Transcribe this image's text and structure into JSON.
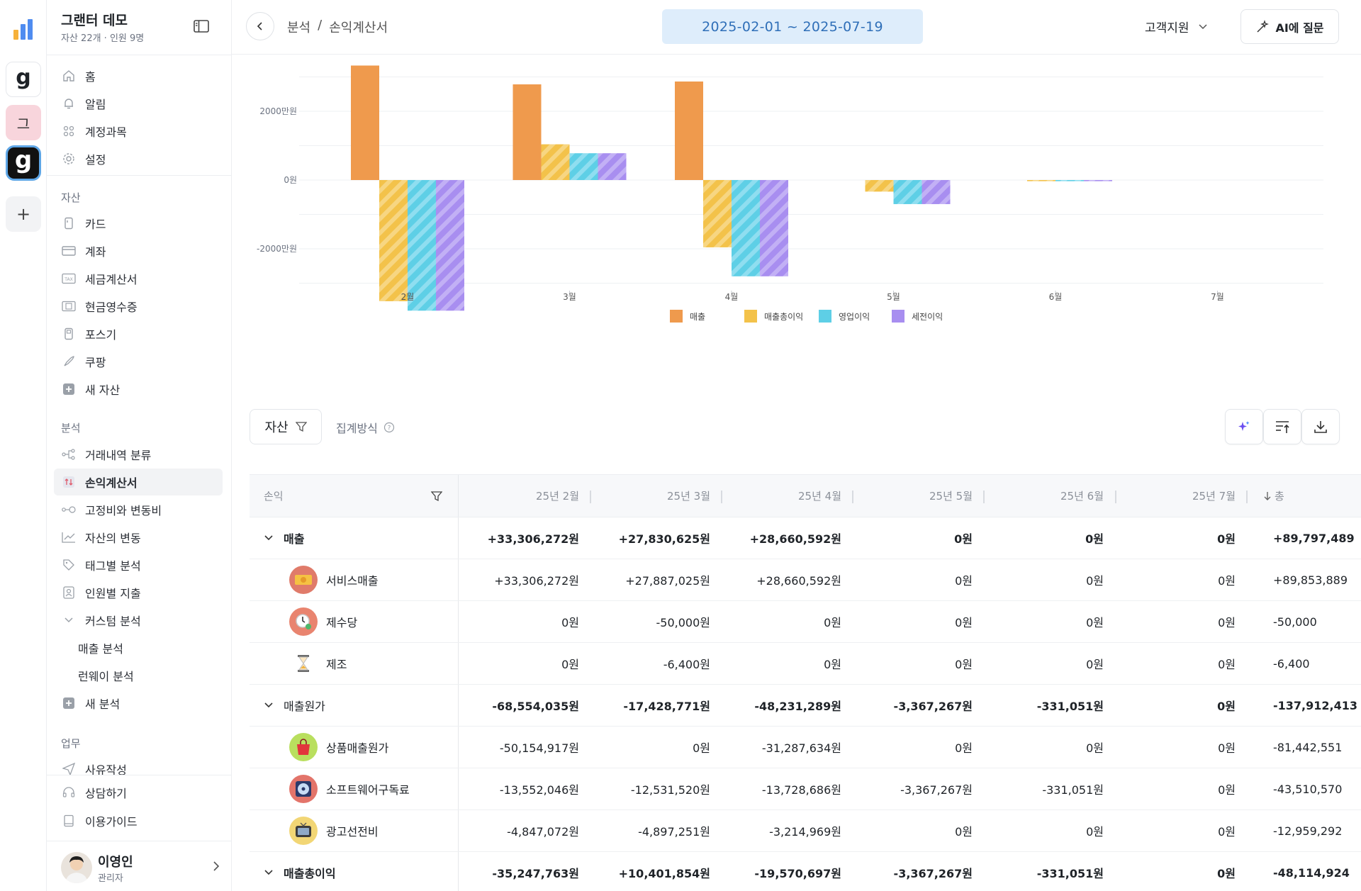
{
  "rail": {
    "items": [
      {
        "name": "analytics-app",
        "label": ""
      },
      {
        "name": "g-workspace-1",
        "label": "g"
      },
      {
        "name": "workspace-geu",
        "label": "그"
      },
      {
        "name": "g-workspace-active",
        "label": "g"
      },
      {
        "name": "add-workspace",
        "label": "+"
      }
    ]
  },
  "sidebar": {
    "workspace_name": "그랜터 데모",
    "workspace_sub": "자산 22개 · 인원 9명",
    "top_items": [
      {
        "label": "홈",
        "icon": "home-icon"
      },
      {
        "label": "알림",
        "icon": "bell-icon"
      },
      {
        "label": "계정과목",
        "icon": "grid-icon"
      },
      {
        "label": "설정",
        "icon": "gear-icon"
      }
    ],
    "assets_label": "자산",
    "asset_items": [
      {
        "label": "카드",
        "icon": "card-icon"
      },
      {
        "label": "계좌",
        "icon": "bank-icon"
      },
      {
        "label": "세금계산서",
        "icon": "tax-icon"
      },
      {
        "label": "현금영수증",
        "icon": "receipt-icon"
      },
      {
        "label": "포스기",
        "icon": "pos-icon"
      },
      {
        "label": "쿠팡",
        "icon": "rocket-icon"
      },
      {
        "label": "새 자산",
        "icon": "plus-square-icon"
      }
    ],
    "analysis_label": "분석",
    "analysis_items": [
      {
        "label": "거래내역 분류",
        "icon": "flow-icon"
      },
      {
        "label": "손익계산서",
        "icon": "pl-icon"
      },
      {
        "label": "고정비와 변동비",
        "icon": "dots-icon"
      },
      {
        "label": "자산의 변동",
        "icon": "trend-icon"
      },
      {
        "label": "태그별 분석",
        "icon": "tag-icon"
      },
      {
        "label": "인원별 지출",
        "icon": "person-icon"
      },
      {
        "label": "커스텀 분석",
        "icon": "chevron-down-icon"
      }
    ],
    "custom_sub_items": [
      "매출 분석",
      "런웨이 분석"
    ],
    "new_analysis": "새 분석",
    "work_label": "업무",
    "work_items": [
      {
        "label": "사유작성",
        "icon": "send-icon"
      }
    ],
    "bottom_items": [
      {
        "label": "상담하기",
        "icon": "headset-icon"
      },
      {
        "label": "이용가이드",
        "icon": "book-icon"
      }
    ],
    "user_name": "이영인",
    "user_role": "관리자"
  },
  "header": {
    "breadcrumb_1": "분석",
    "breadcrumb_sep": "/",
    "breadcrumb_2": "손익계산서",
    "date_range": "2025-02-01 ~ 2025-07-19",
    "support_label": "고객지원",
    "ai_button": "AI에 질문"
  },
  "chart_data": {
    "type": "bar",
    "categories": [
      "2월",
      "3월",
      "4월",
      "5월",
      "6월",
      "7월"
    ],
    "y_ticks": [
      {
        "value": 20000000,
        "label": "2000만원"
      },
      {
        "value": 0,
        "label": "0원"
      },
      {
        "value": -20000000,
        "label": "-2000만원"
      }
    ],
    "ylim": [
      -40000000,
      33306272
    ],
    "series": [
      {
        "name": "매출",
        "color": "#ef9a4d",
        "pattern": false,
        "values": [
          33306272,
          27830625,
          28660592,
          0,
          0,
          0
        ]
      },
      {
        "name": "매출총이익",
        "color": "#f3c24a",
        "pattern": true,
        "values": [
          -35247763,
          10401854,
          -19570697,
          -3367267,
          -331051,
          0
        ]
      },
      {
        "name": "영업이익",
        "color": "#5ecfe6",
        "pattern": true,
        "values": [
          -38000000,
          7800000,
          -28000000,
          -7000000,
          -331051,
          0
        ]
      },
      {
        "name": "세전이익",
        "color": "#a88ef0",
        "pattern": true,
        "values": [
          -38000000,
          7800000,
          -28000000,
          -7000000,
          -331051,
          0
        ]
      }
    ]
  },
  "toolbar": {
    "assets_filter": "자산",
    "aggregation": "집계방식"
  },
  "table": {
    "first_col_header": "손익",
    "columns": [
      "25년 2월",
      "25년 3월",
      "25년 4월",
      "25년 5월",
      "25년 6월",
      "25년 7월",
      "총"
    ],
    "rows": [
      {
        "type": "group",
        "label": "매출",
        "values": [
          "+33,306,272원",
          "+27,830,625원",
          "+28,660,592원",
          "0원",
          "0원",
          "0원",
          "+89,797,489"
        ]
      },
      {
        "type": "item",
        "label": "서비스매출",
        "icon": "money-icon",
        "icon_bg": "#e07b6a",
        "values": [
          "+33,306,272원",
          "+27,887,025원",
          "+28,660,592원",
          "0원",
          "0원",
          "0원",
          "+89,853,889"
        ]
      },
      {
        "type": "item",
        "label": "제수당",
        "icon": "clock-icon",
        "icon_bg": "#e9846f",
        "values": [
          "0원",
          "-50,000원",
          "0원",
          "0원",
          "0원",
          "0원",
          "-50,000"
        ]
      },
      {
        "type": "item",
        "label": "제조",
        "icon": "hourglass-icon",
        "icon_bg": "#ffffff",
        "values": [
          "0원",
          "-6,400원",
          "0원",
          "0원",
          "0원",
          "0원",
          "-6,400"
        ]
      },
      {
        "type": "group",
        "label": "매출원가",
        "values": [
          "-68,554,035원",
          "-17,428,771원",
          "-48,231,289원",
          "-3,367,267원",
          "-331,051원",
          "0원",
          "-137,912,413"
        ]
      },
      {
        "type": "item",
        "label": "상품매출원가",
        "icon": "shopping-bag-icon",
        "icon_bg": "#b9df5e",
        "values": [
          "-50,154,917원",
          "0원",
          "-31,287,634원",
          "0원",
          "0원",
          "0원",
          "-81,442,551"
        ]
      },
      {
        "type": "item",
        "label": "소프트웨어구독료",
        "icon": "disc-icon",
        "icon_bg": "#e3746a",
        "values": [
          "-13,552,046원",
          "-12,531,520원",
          "-13,728,686원",
          "-3,367,267원",
          "-331,051원",
          "0원",
          "-43,510,570"
        ]
      },
      {
        "type": "item",
        "label": "광고선전비",
        "icon": "tv-icon",
        "icon_bg": "#f2d675",
        "values": [
          "-4,847,072원",
          "-4,897,251원",
          "-3,214,969원",
          "0원",
          "0원",
          "0원",
          "-12,959,292"
        ]
      },
      {
        "type": "group",
        "label": "매출총이익",
        "values": [
          "-35,247,763원",
          "+10,401,854원",
          "-19,570,697원",
          "-3,367,267원",
          "-331,051원",
          "0원",
          "-48,114,924"
        ]
      }
    ]
  }
}
